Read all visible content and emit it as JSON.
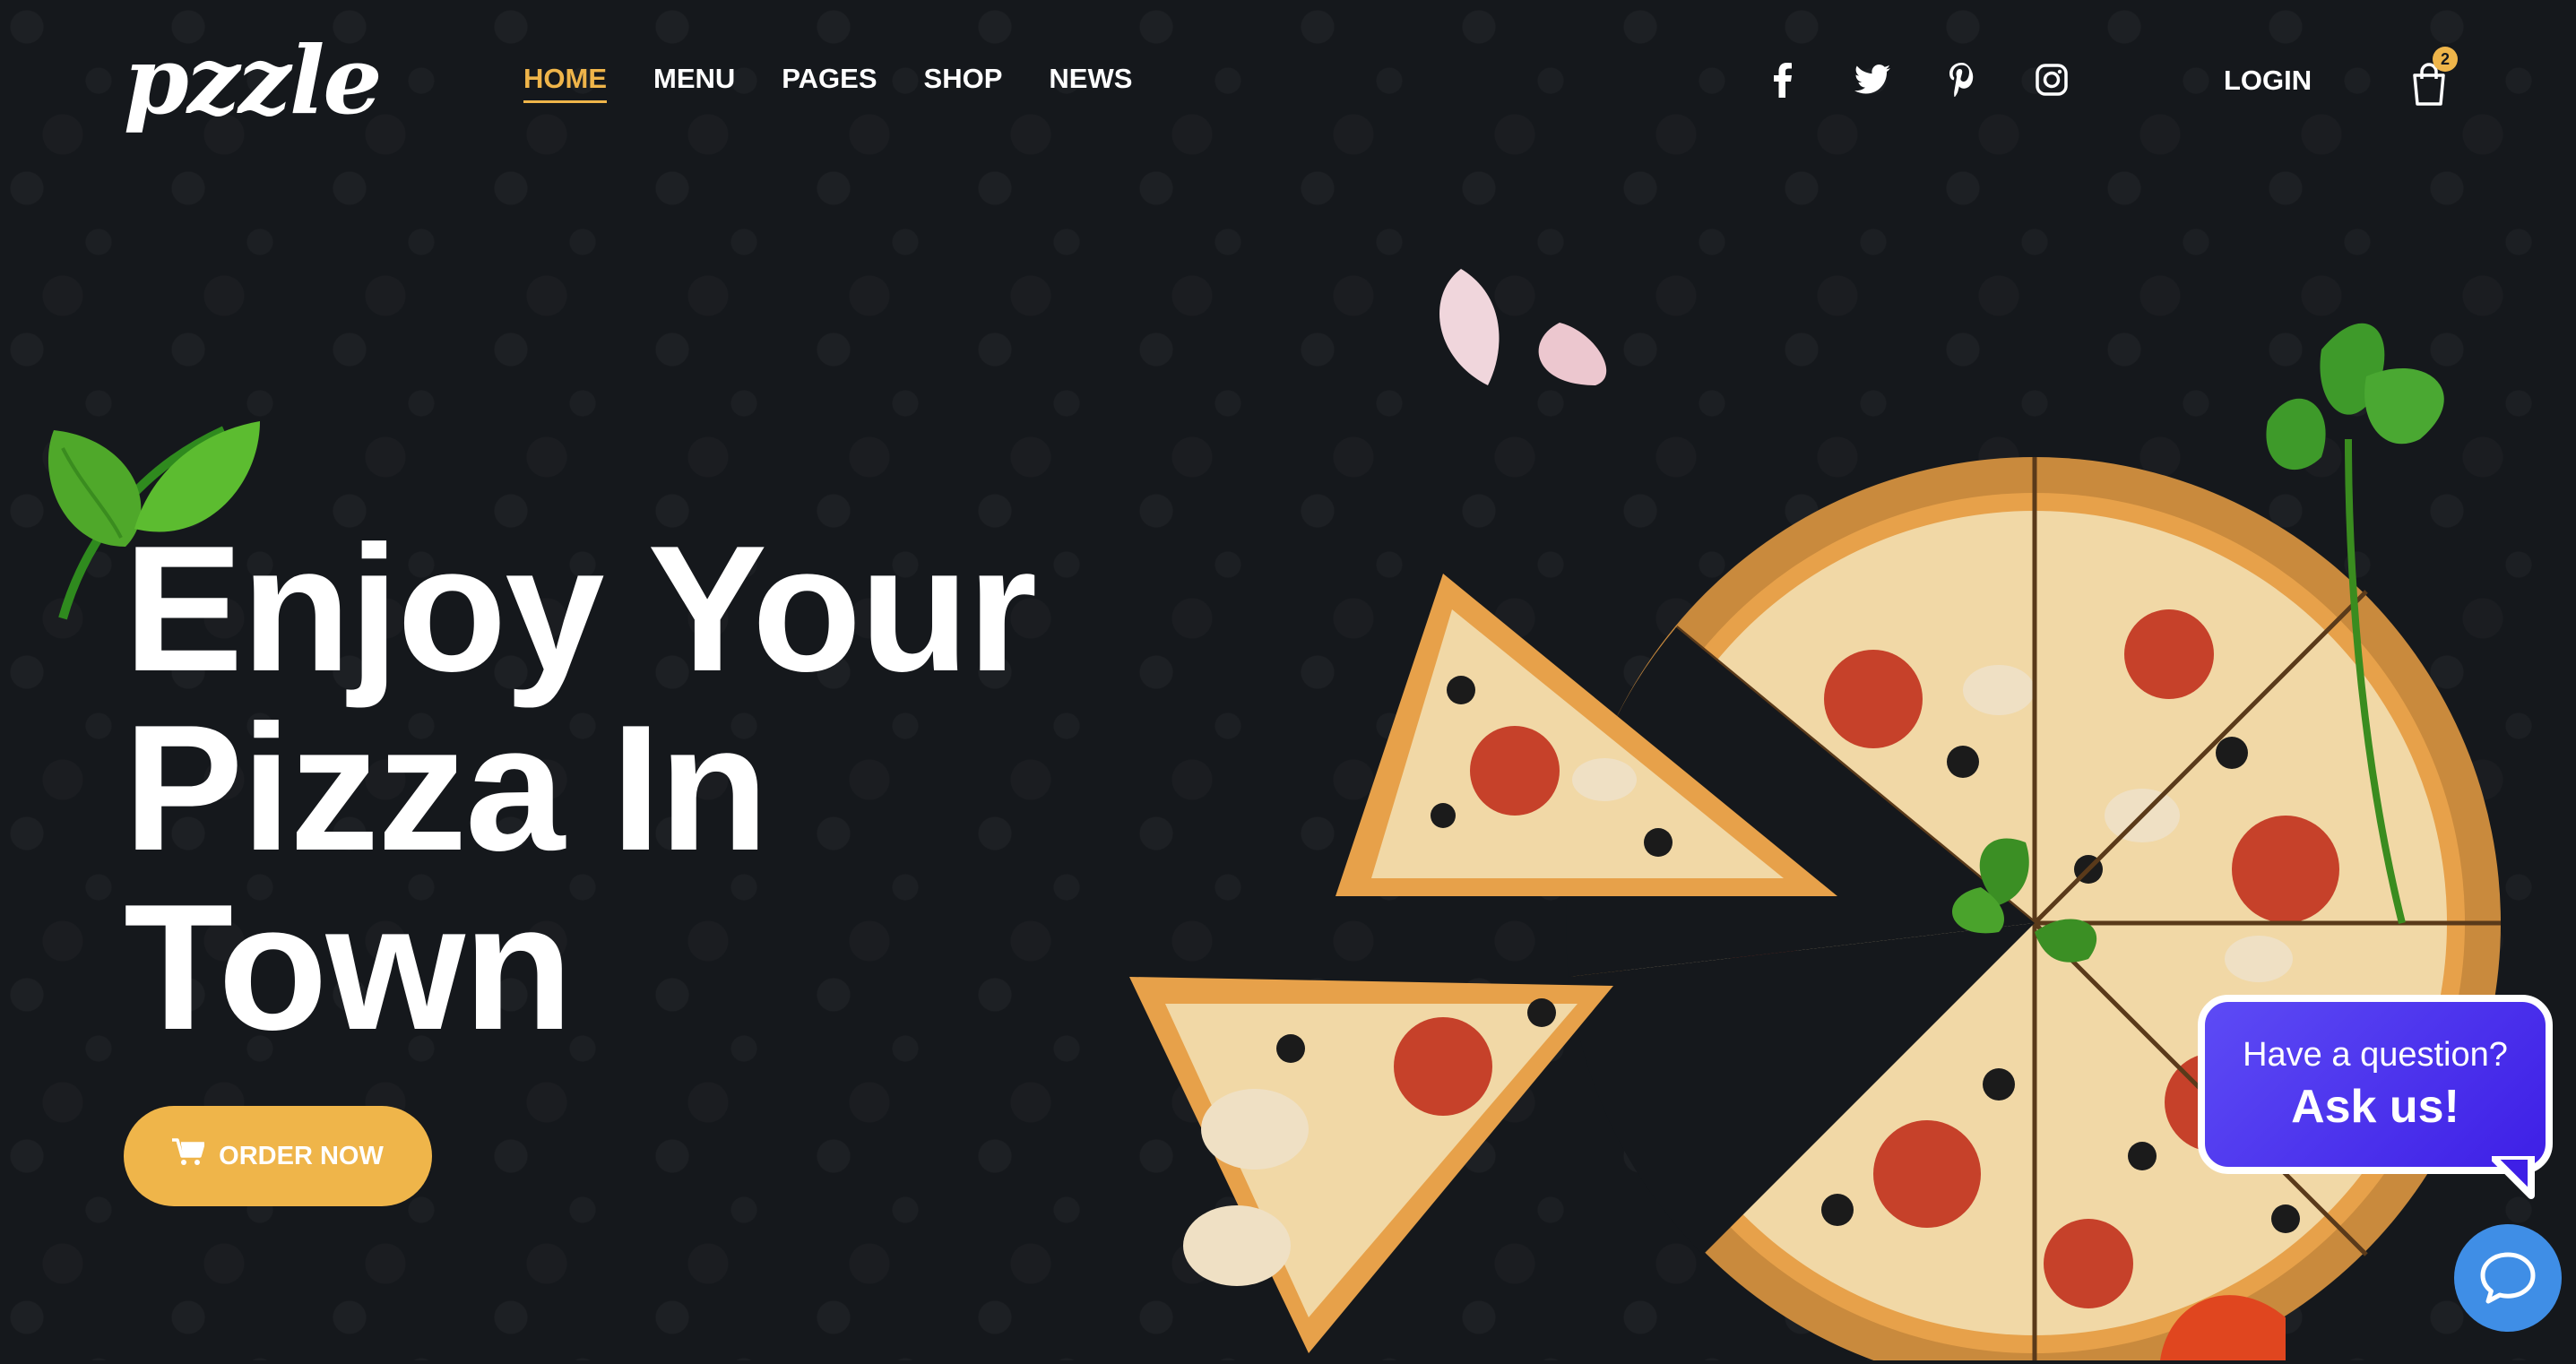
{
  "brand": {
    "logo_text": "pzzle"
  },
  "nav": {
    "items": [
      {
        "label": "HOME"
      },
      {
        "label": "MENU"
      },
      {
        "label": "PAGES"
      },
      {
        "label": "SHOP"
      },
      {
        "label": "NEWS"
      }
    ]
  },
  "social": [
    "facebook-icon",
    "twitter-icon",
    "pinterest-icon",
    "instagram-icon"
  ],
  "header": {
    "login_label": "LOGIN",
    "cart_count": "2"
  },
  "hero": {
    "headline_line1": "Enjoy Your",
    "headline_line2": "Pizza In",
    "headline_line3": "Town",
    "order_label": "ORDER NOW"
  },
  "chat": {
    "question": "Have a question?",
    "cta": "Ask us!"
  },
  "colors": {
    "background": "#15181c",
    "accent": "#efb54a",
    "chat_purple": "#4b32ee",
    "chat_launcher": "#3f8ee6"
  }
}
